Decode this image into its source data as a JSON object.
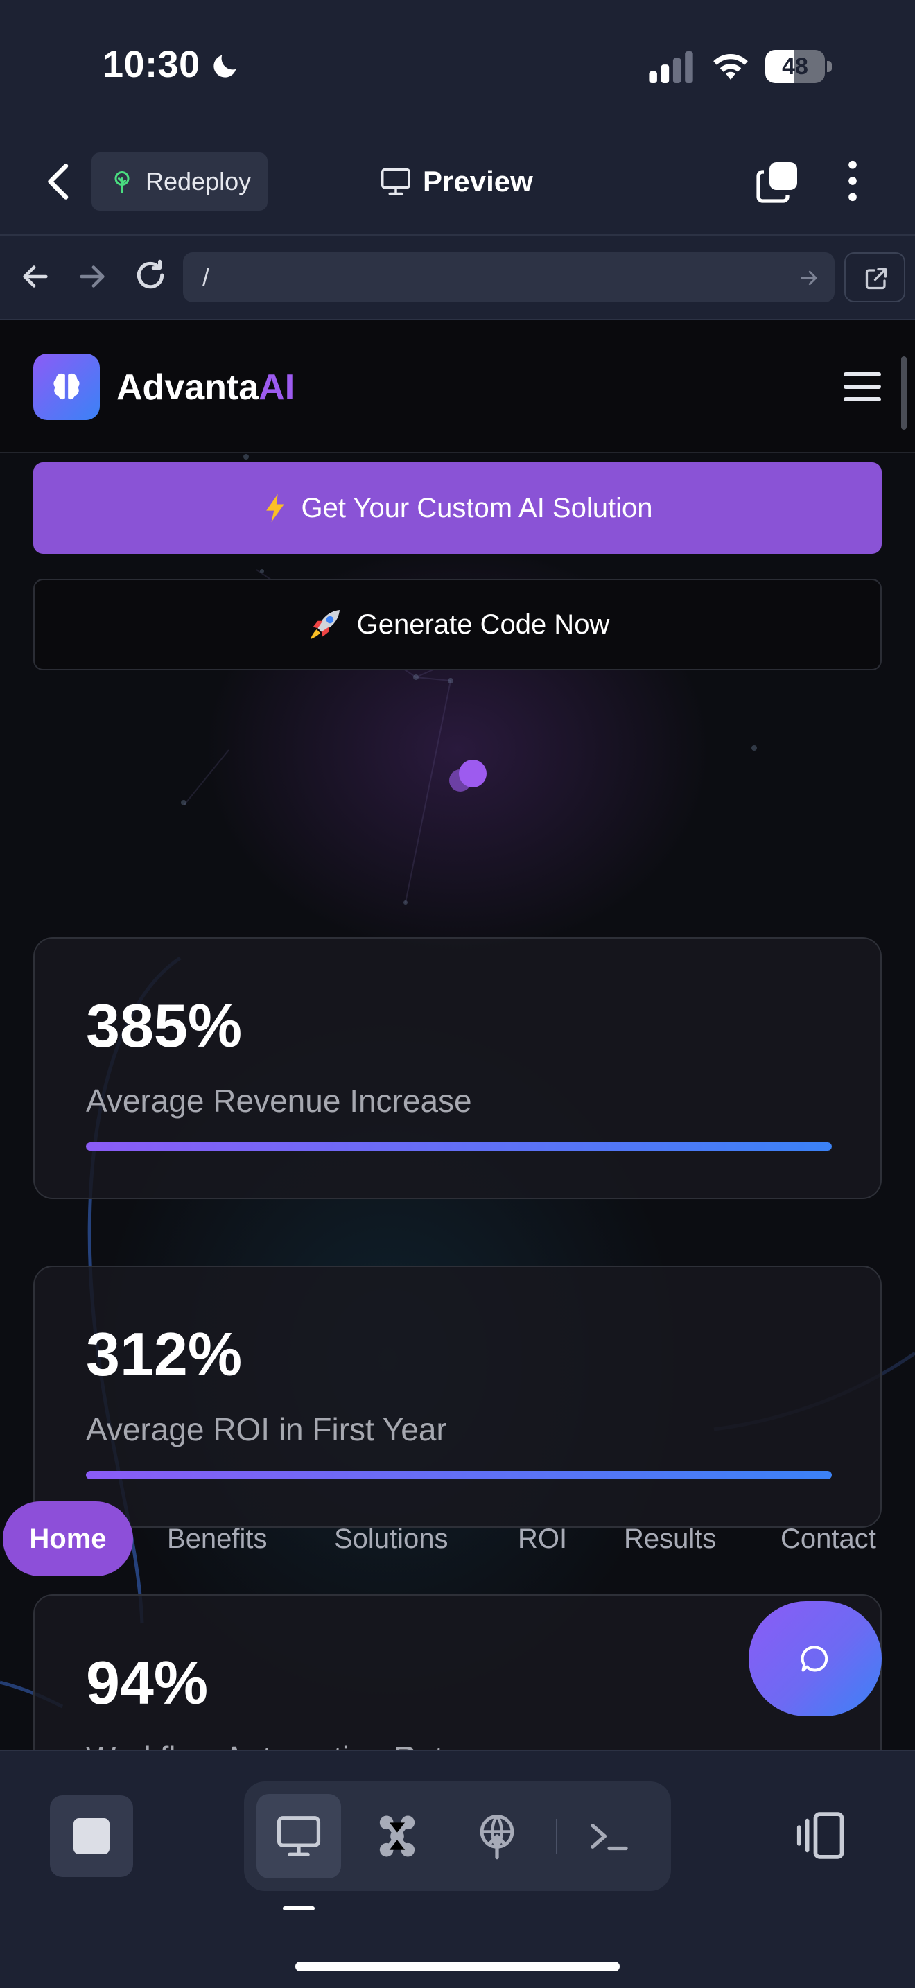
{
  "status_bar": {
    "time": "10:30",
    "battery_level": "48"
  },
  "app_header": {
    "redeploy_label": "Redeploy",
    "title": "Preview"
  },
  "browser": {
    "url": "/"
  },
  "site": {
    "brand_main": "Advanta",
    "brand_accent": "AI",
    "cta_primary": "Get Your Custom AI Solution",
    "cta_secondary": "Generate Code Now",
    "stats": [
      {
        "value": "385%",
        "label": "Average Revenue Increase",
        "progress": 1.0
      },
      {
        "value": "312%",
        "label": "Average ROI in First Year",
        "progress": 1.0
      },
      {
        "value": "94%",
        "label": "Workflow Automation Rate",
        "progress": 1.0
      }
    ],
    "section_nav": [
      "Home",
      "Benefits",
      "Solutions",
      "ROI",
      "Results",
      "Contact"
    ],
    "active_section": "Home"
  },
  "colors": {
    "accent_purple": "#8a53d6",
    "accent_blue": "#3b82f6",
    "chrome_bg": "#1d2233",
    "page_bg": "#0c0d12"
  },
  "icons": {
    "header": [
      "back-icon",
      "leaf-icon",
      "monitor-icon",
      "tabs-icon",
      "more-vertical-icon"
    ],
    "browser": [
      "arrow-left-icon",
      "arrow-right-icon",
      "reload-icon",
      "arrow-go-icon",
      "external-link-icon"
    ],
    "toolbar": [
      "stop-icon",
      "monitor-icon",
      "workflow-icon",
      "deploy-icon",
      "terminal-icon",
      "panels-icon"
    ]
  }
}
